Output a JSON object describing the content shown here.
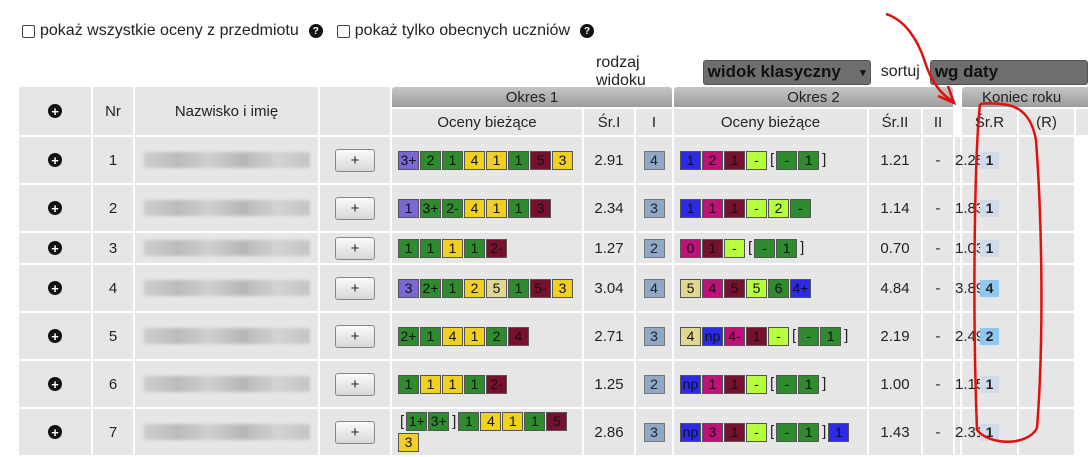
{
  "options": {
    "show_all": "pokaż wszystkie oceny z przedmiotu",
    "show_present": "pokaż tylko obecnych uczniów",
    "help": "?"
  },
  "view": {
    "view_label": "rodzaj widoku",
    "view_value": "widok klasyczny",
    "sort_label": "sortuj",
    "sort_value": "wg daty"
  },
  "periods": {
    "p1": "Okres 1",
    "p2": "Okres 2",
    "end": "Koniec roku"
  },
  "columns": {
    "nr": "Nr",
    "name": "Nazwisko i imię",
    "grades": "Oceny bieżące",
    "avg1": "Śr.I",
    "final1": "I",
    "avg2": "Śr.II",
    "final2": "II",
    "avgR": "Śr.R",
    "finalR": "(R)"
  },
  "button_plus": "+",
  "colors": {
    "purple": "#7b68d6",
    "green": "#2e8b2e",
    "yellow": "#f0d020",
    "maroon": "#7a1030",
    "blue": "#2a2ae8",
    "magenta": "#c0107a",
    "lime": "#b7ff3c",
    "tan": "#e0d890",
    "darkgreen": "#2e6e2e"
  },
  "rows": [
    {
      "nr": "1",
      "g1": [
        [
          "3+",
          "purple"
        ],
        [
          "2",
          "green"
        ],
        [
          "1",
          "green"
        ],
        [
          "4",
          "yellow"
        ],
        [
          "1",
          "yellow"
        ],
        [
          "1",
          "green"
        ],
        [
          "5",
          "maroon"
        ],
        [
          "3",
          "yellow"
        ]
      ],
      "avg1": "2.91",
      "f1": "4",
      "g2": [
        [
          "1",
          "blue"
        ],
        [
          "2",
          "magenta"
        ],
        [
          "1",
          "maroon"
        ],
        [
          "-",
          "lime"
        ],
        "[",
        [
          "-",
          "green"
        ],
        [
          "1",
          "green"
        ],
        "]"
      ],
      "avg2": "1.21",
      "f2": "-",
      "avgR": "2.25",
      "fR": "1"
    },
    {
      "nr": "2",
      "g1": [
        [
          "1",
          "purple"
        ],
        [
          "3+",
          "green"
        ],
        [
          "2-",
          "green"
        ],
        [
          "4",
          "yellow"
        ],
        [
          "1",
          "yellow"
        ],
        [
          "1",
          "green"
        ],
        [
          "3",
          "maroon"
        ]
      ],
      "avg1": "2.34",
      "f1": "3",
      "g2": [
        [
          "1",
          "blue"
        ],
        [
          "1",
          "magenta"
        ],
        [
          "1",
          "maroon"
        ],
        [
          "-",
          "lime"
        ],
        [
          "2",
          "lime"
        ],
        [
          "-",
          "green"
        ]
      ],
      "avg2": "1.14",
      "f2": "-",
      "avgR": "1.83",
      "fR": "1"
    },
    {
      "nr": "3",
      "g1": [
        [
          "1",
          "green"
        ],
        [
          "1",
          "green"
        ],
        [
          "1",
          "yellow"
        ],
        [
          "1",
          "green"
        ],
        [
          "2-",
          "maroon"
        ]
      ],
      "avg1": "1.27",
      "f1": "2",
      "g2": [
        [
          "0",
          "magenta"
        ],
        [
          "1",
          "maroon"
        ],
        [
          "-",
          "lime"
        ],
        "[",
        [
          "-",
          "green"
        ],
        [
          "1",
          "green"
        ],
        "]"
      ],
      "avg2": "0.70",
      "f2": "-",
      "avgR": "1.03",
      "fR": "1"
    },
    {
      "nr": "4",
      "g1": [
        [
          "3",
          "purple"
        ],
        [
          "2+",
          "green"
        ],
        [
          "1",
          "green"
        ],
        [
          "2",
          "yellow"
        ],
        [
          "5",
          "tan"
        ],
        [
          "1",
          "green"
        ],
        [
          "5-",
          "maroon"
        ],
        [
          "3",
          "yellow"
        ]
      ],
      "avg1": "3.04",
      "f1": "4",
      "g2": [
        [
          "5",
          "tan"
        ],
        [
          "4",
          "magenta"
        ],
        [
          "5",
          "maroon"
        ],
        [
          "5",
          "lime"
        ],
        [
          "6",
          "green"
        ],
        [
          "4+",
          "blue"
        ]
      ],
      "avg2": "4.84",
      "f2": "-",
      "avgR": "3.89",
      "fR": "4"
    },
    {
      "nr": "5",
      "g1": [
        [
          "2+",
          "green"
        ],
        [
          "1",
          "green"
        ],
        [
          "4",
          "yellow"
        ],
        [
          "1",
          "yellow"
        ],
        [
          "2",
          "green"
        ],
        [
          "4",
          "maroon"
        ]
      ],
      "avg1": "2.71",
      "f1": "3",
      "g2": [
        [
          "4",
          "tan"
        ],
        [
          "np",
          "blue"
        ],
        [
          "4-",
          "magenta"
        ],
        [
          "1",
          "maroon"
        ],
        [
          "-",
          "lime"
        ],
        "[",
        [
          "-",
          "green"
        ],
        [
          "1",
          "green"
        ],
        "]"
      ],
      "avg2": "2.19",
      "f2": "-",
      "avgR": "2.49",
      "fR": "2"
    },
    {
      "nr": "6",
      "g1": [
        [
          "1",
          "green"
        ],
        [
          "1",
          "yellow"
        ],
        [
          "1",
          "yellow"
        ],
        [
          "1",
          "green"
        ],
        [
          "2-",
          "maroon"
        ]
      ],
      "avg1": "1.25",
      "f1": "2",
      "g2": [
        [
          "np",
          "blue"
        ],
        [
          "1",
          "magenta"
        ],
        [
          "1",
          "maroon"
        ],
        [
          "-",
          "lime"
        ],
        "[",
        [
          "-",
          "green"
        ],
        [
          "1",
          "green"
        ],
        "]"
      ],
      "avg2": "1.00",
      "f2": "-",
      "avgR": "1.15",
      "fR": "1"
    },
    {
      "nr": "7",
      "g1": [
        "[",
        [
          "1+",
          "green"
        ],
        [
          "3+",
          "green"
        ],
        "]",
        [
          "1",
          "green"
        ],
        [
          "4",
          "yellow"
        ],
        [
          "1",
          "yellow"
        ],
        [
          "1",
          "green"
        ],
        [
          "5",
          "maroon"
        ],
        [
          "3",
          "yellow"
        ]
      ],
      "avg1": "2.86",
      "f1": "3",
      "g2": [
        [
          "np",
          "blue"
        ],
        [
          "3",
          "magenta"
        ],
        [
          "1",
          "maroon"
        ],
        [
          "-",
          "lime"
        ],
        "[",
        [
          "-",
          "green"
        ],
        [
          "1",
          "green"
        ],
        "]",
        [
          "1",
          "blue"
        ]
      ],
      "avg2": "1.43",
      "f2": "-",
      "avgR": "2.31",
      "fR": "1"
    }
  ]
}
